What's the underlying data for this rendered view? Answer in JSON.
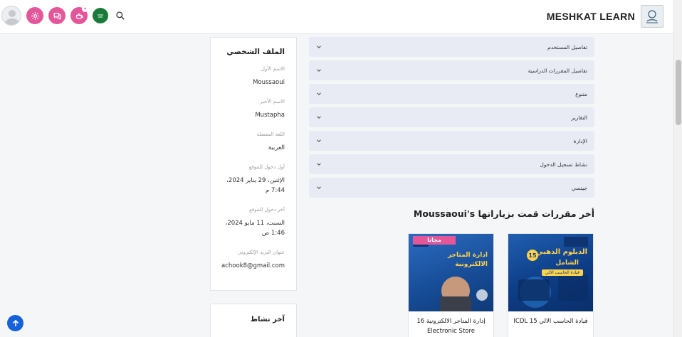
{
  "header": {
    "brand_name": "MESHKAT LEARN"
  },
  "profile": {
    "title": "الملف الشخصي",
    "fields": [
      {
        "label": "الاسم الأول",
        "value": "Moussaoui"
      },
      {
        "label": "الاسم الأخير",
        "value": "Mustapha"
      },
      {
        "label": "اللغة المفضلة",
        "value": "العربية"
      },
      {
        "label": "أول دخول للموقع",
        "value": "الإثنين، 29 يناير 2024، 7:44 م"
      },
      {
        "label": "آخر دخول للموقع",
        "value": "السبت، 11 مايو 2024، 1:46 ص"
      },
      {
        "label": "عنوان البريد الإلكتروني",
        "value": "achook8@gmail.com"
      }
    ]
  },
  "activity": {
    "title": "آخر نشاط"
  },
  "accordions": [
    {
      "label": "تفاصيل المستخدم"
    },
    {
      "label": "تفاصيل المقررات الدراسية"
    },
    {
      "label": "متنوع"
    },
    {
      "label": "التقارير"
    },
    {
      "label": "الإدارة"
    },
    {
      "label": "نشاط تسجيل الدخول"
    },
    {
      "label": "جيتسي"
    }
  ],
  "recent": {
    "heading": "Moussaoui's أخر مقررات قمت بزياراتها",
    "courses": [
      {
        "title": "قيادة الحاسب الالي 15 ICDL",
        "thumb_text_1": "الدبلوم الذهبي",
        "thumb_text_2": "الشامل",
        "thumb_text_3": "قيادة الحاسب الالي",
        "thumb_badge": "15"
      },
      {
        "title": "إدارة المتاجر الالكترونية 16 Electronic Store",
        "thumb_text_1": "مجانا",
        "thumb_text_2": "ادارة المتاجر الالكترونية"
      }
    ]
  },
  "colors": {
    "accent_pink": "#e4569a",
    "accordion_bg": "#e9ebf4",
    "fab_blue": "#1662d8"
  }
}
